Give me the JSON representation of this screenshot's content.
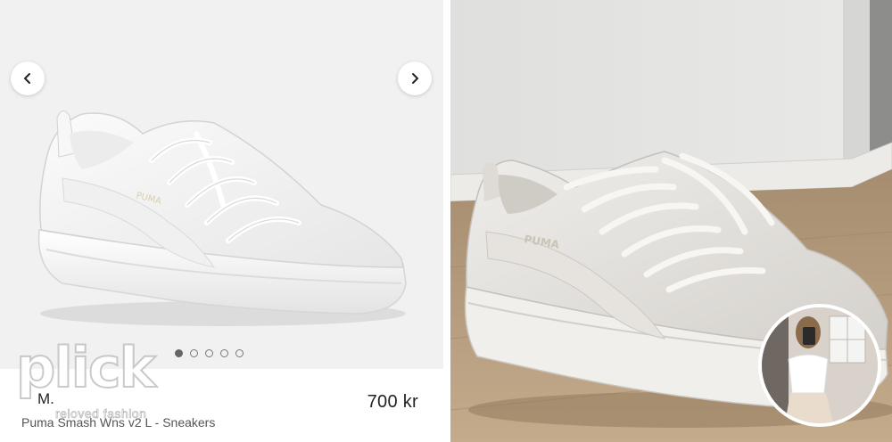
{
  "listing": {
    "seller_initial": "M.",
    "price": "700 kr",
    "title": "Puma Smash Wns v2 L - Sneakers"
  },
  "gallery": {
    "total_images": 5,
    "active_index": 0,
    "prev_icon": "chevron-left-icon",
    "next_icon": "chevron-right-icon"
  },
  "branding": {
    "logo": "plick",
    "tagline": "reloved fashion"
  },
  "product_brand_mark": "PUMA",
  "colors": {
    "studio_bg": "#f1f1f1",
    "dot_active": "#666666",
    "floor_wood": "#b59a7a",
    "wall": "#e9e9e7"
  }
}
